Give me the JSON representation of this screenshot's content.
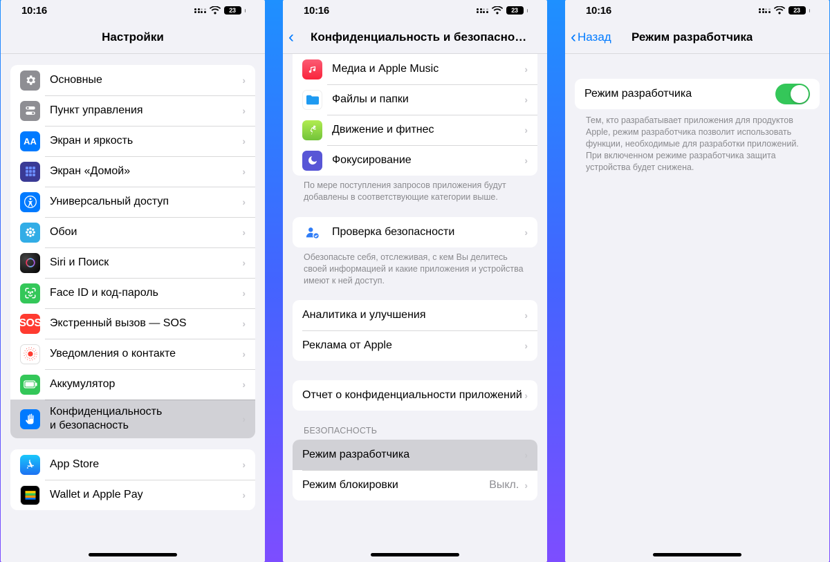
{
  "status": {
    "time": "10:16",
    "battery": "23"
  },
  "screen1": {
    "title": "Настройки",
    "group1": [
      {
        "label": "Основные"
      },
      {
        "label": "Пункт управления"
      },
      {
        "label": "Экран и яркость"
      },
      {
        "label": "Экран «Домой»"
      },
      {
        "label": "Универсальный доступ"
      },
      {
        "label": "Обои"
      },
      {
        "label": "Siri и Поиск"
      },
      {
        "label": "Face ID и код‑пароль"
      },
      {
        "label": "Экстренный вызов — SOS"
      },
      {
        "label": "Уведомления о контакте"
      },
      {
        "label": "Аккумулятор"
      },
      {
        "label": "Конфиденциальность\nи безопасность"
      }
    ],
    "group2": [
      {
        "label": "App Store"
      },
      {
        "label": "Wallet и Apple Pay"
      }
    ]
  },
  "screen2": {
    "title": "Конфиденциальность и безопасно…",
    "groupA": [
      {
        "label": "Медиа и Apple Music"
      },
      {
        "label": "Файлы и папки"
      },
      {
        "label": "Движение и фитнес"
      },
      {
        "label": "Фокусирование"
      }
    ],
    "footerA": "По мере поступления запросов приложения будут добавлены в соответствующие категории выше.",
    "groupB": [
      {
        "label": "Проверка безопасности"
      }
    ],
    "footerB": "Обезопасьте себя, отслеживая, с кем Вы делитесь своей информацией и какие приложения и устройства имеют к ней доступ.",
    "groupC": [
      {
        "label": "Аналитика и улучшения"
      },
      {
        "label": "Реклама от Apple"
      }
    ],
    "groupD": [
      {
        "label": "Отчет о конфиденциальности приложений"
      }
    ],
    "headerE": "Безопасность",
    "groupE": [
      {
        "label": "Режим разработчика"
      },
      {
        "label": "Режим блокировки",
        "value": "Выкл."
      }
    ]
  },
  "screen3": {
    "back": "Назад",
    "title": "Режим разработчика",
    "toggleLabel": "Режим разработчика",
    "desc": "Тем, кто разрабатывает приложения для продуктов Apple, режим разработчика позволит использовать функции, необходимые для разработки приложений. При включенном режиме разработчика защита устройства будет снижена."
  }
}
